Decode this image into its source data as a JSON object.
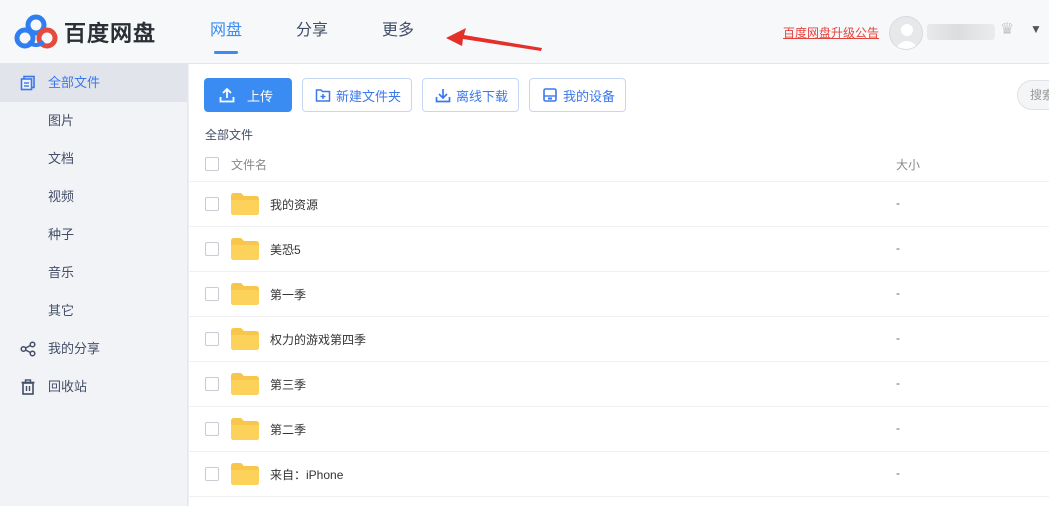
{
  "brand": {
    "name": "百度网盘"
  },
  "colors": {
    "accent": "#3b8cf2",
    "notice": "#e5443c",
    "folder": "#fcd25a"
  },
  "nav": [
    {
      "label": "网盘",
      "active": true
    },
    {
      "label": "分享",
      "active": false
    },
    {
      "label": "更多",
      "active": false
    }
  ],
  "header": {
    "notice": "百度网盘升级公告",
    "dropdown_icon": "chevron-down-icon",
    "crown_icon": "crown-icon"
  },
  "sidebar": {
    "items": [
      {
        "label": "全部文件",
        "icon": "files-icon",
        "active": true
      },
      {
        "label": "图片"
      },
      {
        "label": "文档"
      },
      {
        "label": "视频"
      },
      {
        "label": "种子"
      },
      {
        "label": "音乐"
      },
      {
        "label": "其它"
      },
      {
        "label": "我的分享",
        "icon": "share-icon"
      },
      {
        "label": "回收站",
        "icon": "trash-icon"
      }
    ]
  },
  "toolbar": {
    "upload": "上传",
    "new_folder": "新建文件夹",
    "offline_download": "离线下载",
    "my_devices": "我的设备",
    "search_placeholder": "搜索"
  },
  "breadcrumb": "全部文件",
  "table": {
    "col_name": "文件名",
    "col_size": "大小",
    "rows": [
      {
        "name": "我的资源",
        "size": "-"
      },
      {
        "name": "美恐5",
        "size": "-"
      },
      {
        "name": "第一季",
        "size": "-"
      },
      {
        "name": "权力的游戏第四季",
        "size": "-"
      },
      {
        "name": "第三季",
        "size": "-"
      },
      {
        "name": "第二季",
        "size": "-"
      },
      {
        "name": "来自：iPhone",
        "size": "-"
      }
    ]
  }
}
